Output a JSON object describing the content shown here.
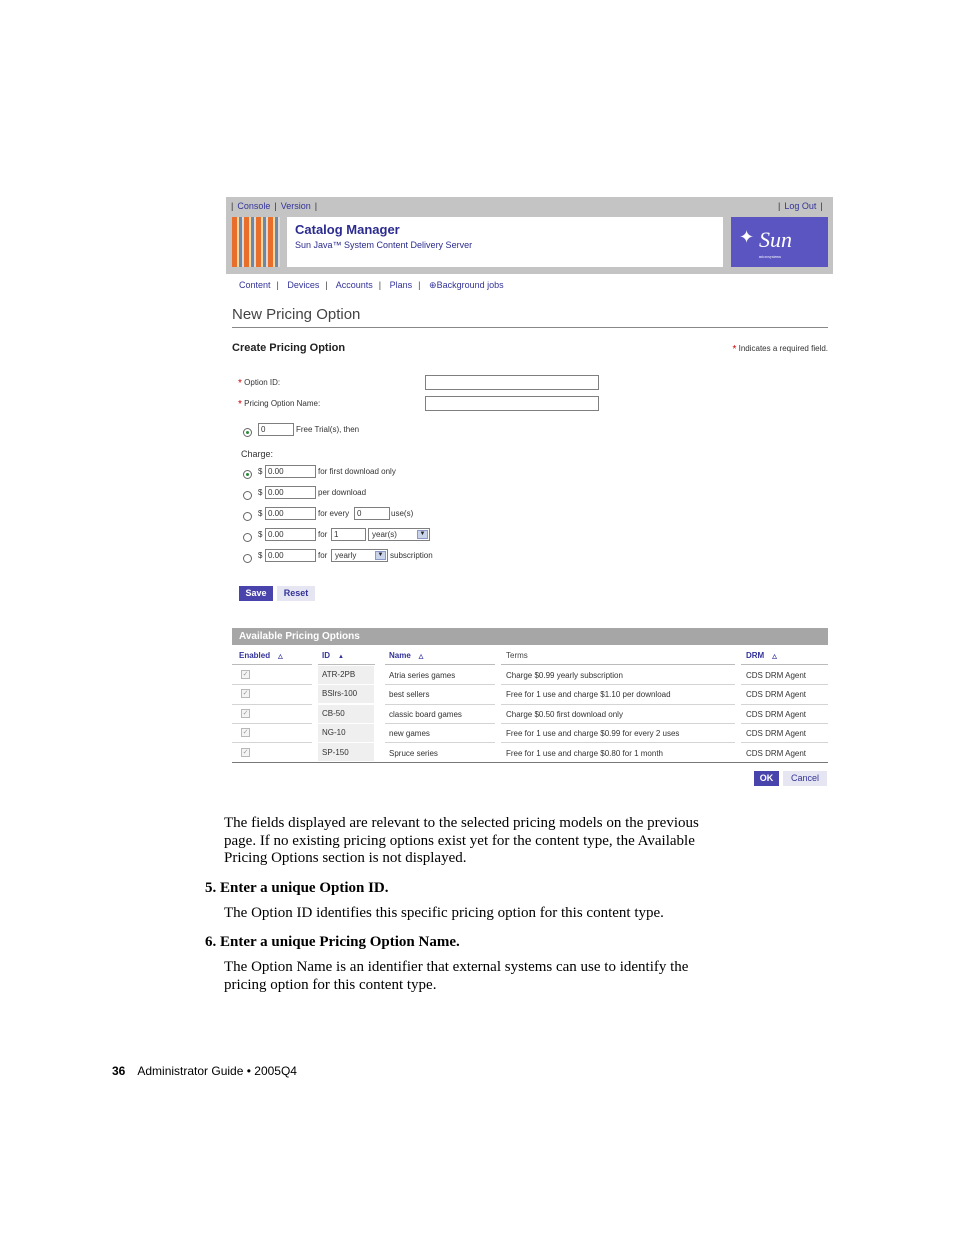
{
  "screenshot": {
    "top_nav": {
      "console": "Console",
      "version": "Version",
      "logout": "Log Out"
    },
    "app_title": "Catalog Manager",
    "app_subtitle": "Sun Java™ System Content Delivery Server",
    "brand": "Sun",
    "brand_tagline": "microsystems",
    "main_nav": [
      "Content",
      "Devices",
      "Accounts",
      "Plans",
      "Background jobs"
    ],
    "page_heading": "New Pricing Option",
    "section_heading": "Create Pricing Option",
    "required_note": "Indicates a required field.",
    "form": {
      "option_id_label": "Option ID:",
      "option_name_label": "Pricing Option Name:",
      "trial_value": "0",
      "trial_suffix": "Free Trial(s), then",
      "charge_label": "Charge:",
      "currency": "$",
      "charge_rows": [
        {
          "value": "0.00",
          "text": "for first download only",
          "selected": true
        },
        {
          "value": "0.00",
          "text": "per download",
          "selected": false
        },
        {
          "value": "0.00",
          "pre": "for every",
          "count": "0",
          "post": "use(s)",
          "selected": false
        },
        {
          "value": "0.00",
          "pre": "for",
          "count": "1",
          "select": "year(s)",
          "selected": false
        },
        {
          "value": "0.00",
          "pre": "for",
          "select": "yearly",
          "post": "subscription",
          "selected": false
        }
      ],
      "save_label": "Save",
      "reset_label": "Reset"
    },
    "table": {
      "title": "Available Pricing Options",
      "headers": {
        "enabled": "Enabled",
        "id": "ID",
        "name": "Name",
        "terms": "Terms",
        "drm": "DRM"
      },
      "rows": [
        {
          "id": "ATR-2PB",
          "name": "Atria series games",
          "terms": "Charge $0.99 yearly subscription",
          "drm": "CDS DRM Agent"
        },
        {
          "id": "BSlrs-100",
          "name": "best sellers",
          "terms": "Free for 1 use and charge $1.10 per download",
          "drm": "CDS DRM Agent"
        },
        {
          "id": "CB-50",
          "name": "classic board games",
          "terms": "Charge $0.50 first download only",
          "drm": "CDS DRM Agent"
        },
        {
          "id": "NG-10",
          "name": "new games",
          "terms": "Free for 1 use and charge $0.99 for every 2 uses",
          "drm": "CDS DRM Agent"
        },
        {
          "id": "SP-150",
          "name": "Spruce series",
          "terms": "Free for 1 use and charge $0.80 for 1 month",
          "drm": "CDS DRM Agent"
        }
      ],
      "ok_label": "OK",
      "cancel_label": "Cancel"
    }
  },
  "body": {
    "intro": [
      "The fields displayed are relevant to the selected pricing models on the previous",
      "page. If no existing pricing options exist yet for the content type, the Available",
      "Pricing Options section is not displayed."
    ],
    "step5_title": "5. Enter a unique Option ID.",
    "step5_text": "The Option ID identifies this specific pricing option for this content type.",
    "step6_title": "6. Enter a unique Pricing Option Name.",
    "step6_text": [
      "The Option Name is an identifier that external systems can use to identify the",
      "pricing option for this content type."
    ]
  },
  "footer": {
    "page_number": "36",
    "title": "Administrator Guide • 2005Q4"
  }
}
